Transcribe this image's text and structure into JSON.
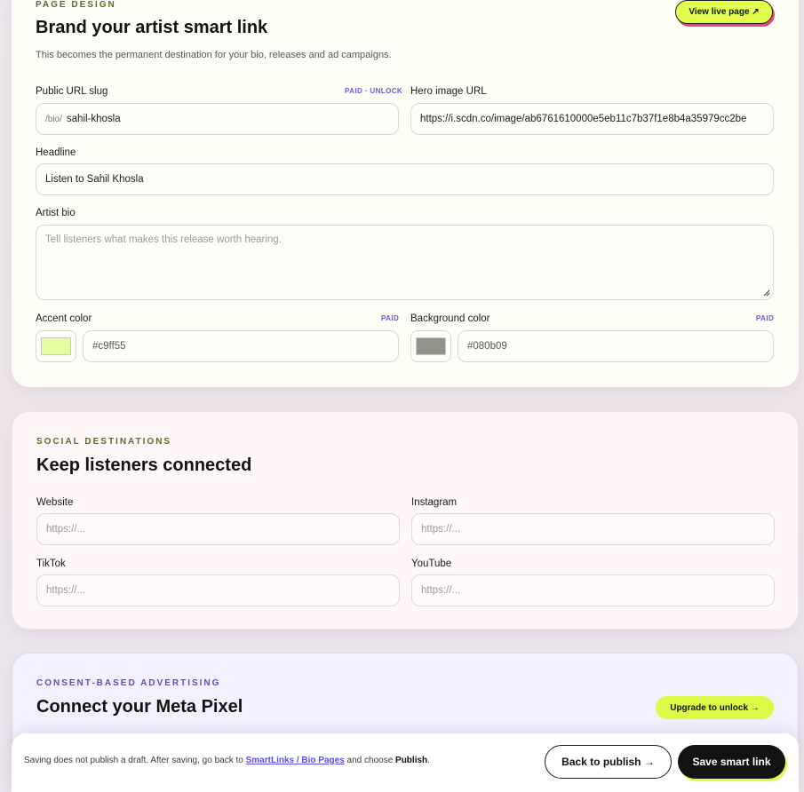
{
  "page_design": {
    "eyebrow": "PAGE DESIGN",
    "title": "Brand your artist smart link",
    "subtitle": "This becomes the permanent destination for your bio, releases and ad campaigns.",
    "view_live_label": "View live page ↗",
    "slug": {
      "label": "Public URL slug",
      "tag": "PAID · UNLOCK",
      "prefix": "/bio/",
      "value": "sahil-khosla"
    },
    "hero": {
      "label": "Hero image URL",
      "value": "https://i.scdn.co/image/ab6761610000e5eb11c7b37f1e8b4a35979cc2be"
    },
    "headline": {
      "label": "Headline",
      "value": "Listen to Sahil Khosla"
    },
    "bio": {
      "label": "Artist bio",
      "placeholder": "Tell listeners what makes this release worth hearing."
    },
    "accent": {
      "label": "Accent color",
      "tag": "PAID",
      "value": "#c9ff55",
      "swatch_color": "#e3ffa2"
    },
    "background": {
      "label": "Background color",
      "tag": "PAID",
      "value": "#080b09",
      "swatch_color": "#93938c"
    }
  },
  "social": {
    "eyebrow": "SOCIAL DESTINATIONS",
    "title": "Keep listeners connected",
    "website": {
      "label": "Website",
      "placeholder": "https://..."
    },
    "instagram": {
      "label": "Instagram",
      "placeholder": "https://..."
    },
    "tiktok": {
      "label": "TikTok",
      "placeholder": "https://..."
    },
    "youtube": {
      "label": "YouTube",
      "placeholder": "https://..."
    }
  },
  "ads": {
    "eyebrow": "CONSENT-BASED ADVERTISING",
    "title": "Connect your Meta Pixel",
    "upgrade_label": "Upgrade to unlock →"
  },
  "footer": {
    "note_before": "Saving does not publish a draft. After saving, go back to ",
    "note_link": "SmartLinks / Bio Pages",
    "note_middle": " and choose ",
    "note_bold": "Publish",
    "note_end": ".",
    "back_label": "Back to publish →",
    "save_label": "Save smart link"
  },
  "colors": {
    "accent_lime": "#e2ff4d",
    "link_violet": "#5b4de6",
    "shadow_pink": "#e4487a"
  }
}
